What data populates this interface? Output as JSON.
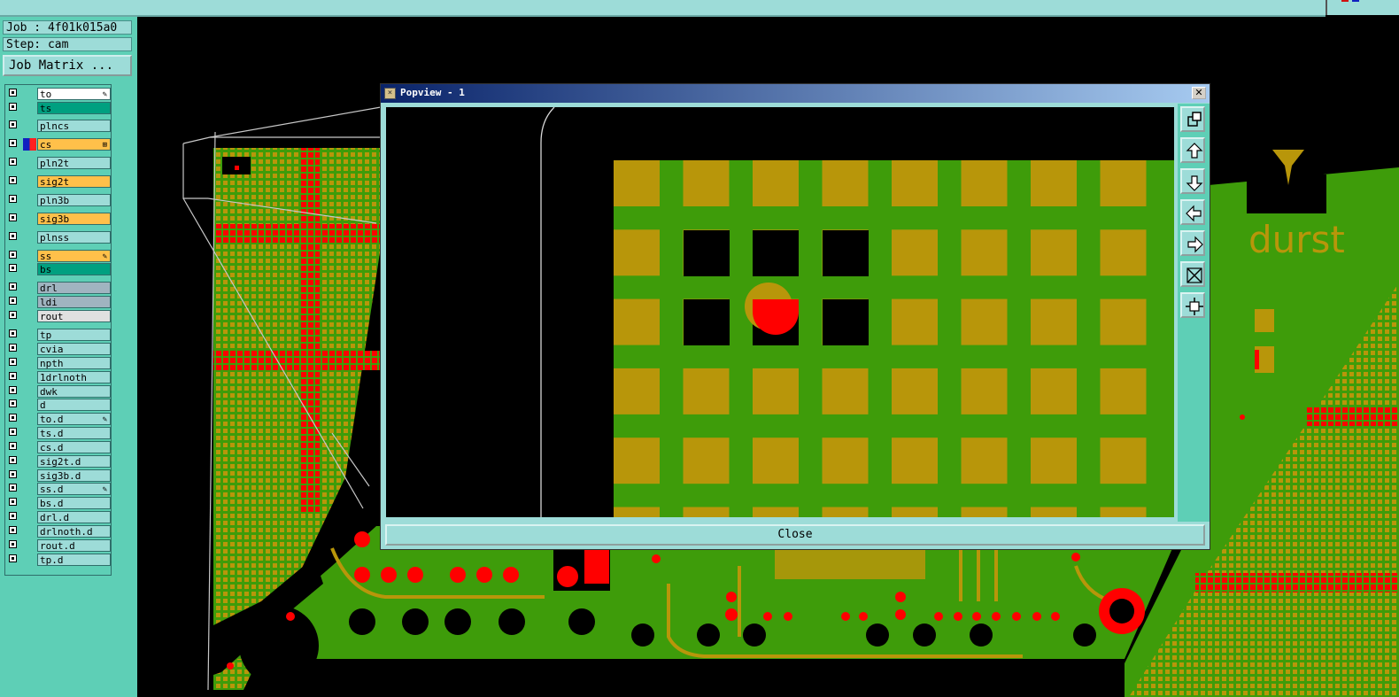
{
  "header": {
    "job_label": "Job : 4f01k015a0",
    "step_label": "Step: cam",
    "job_matrix_button": "Job Matrix ..."
  },
  "layers": [
    {
      "name": "to",
      "color": "#ffffff",
      "mark": "✎"
    },
    {
      "name": "ts",
      "color": "#00a080",
      "mark": ""
    },
    {
      "name": "plncs",
      "color": "#9ddcd8",
      "mark": ""
    },
    {
      "name": "cs",
      "color": "#ffc04a",
      "mark": "⊞"
    },
    {
      "name": "pln2t",
      "color": "#9ddcd8",
      "mark": ""
    },
    {
      "name": "sig2t",
      "color": "#ffc04a",
      "mark": ""
    },
    {
      "name": "pln3b",
      "color": "#9ddcd8",
      "mark": ""
    },
    {
      "name": "sig3b",
      "color": "#ffc04a",
      "mark": ""
    },
    {
      "name": "plnss",
      "color": "#9ddcd8",
      "mark": ""
    },
    {
      "name": "ss",
      "color": "#ffc04a",
      "mark": "✎"
    },
    {
      "name": "bs",
      "color": "#00a080",
      "mark": ""
    },
    {
      "name": "drl",
      "color": "#a0b4c0",
      "mark": ""
    },
    {
      "name": "ldi",
      "color": "#a0b4c0",
      "mark": ""
    },
    {
      "name": "rout",
      "color": "#e0e0e0",
      "mark": ""
    },
    {
      "name": "tp",
      "color": "#9ddcd8",
      "mark": ""
    },
    {
      "name": "cvia",
      "color": "#9ddcd8",
      "mark": ""
    },
    {
      "name": "npth",
      "color": "#9ddcd8",
      "mark": ""
    },
    {
      "name": "1drlnoth",
      "color": "#9ddcd8",
      "mark": ""
    },
    {
      "name": "dwk",
      "color": "#9ddcd8",
      "mark": ""
    },
    {
      "name": "d",
      "color": "#9ddcd8",
      "mark": ""
    },
    {
      "name": "to.d",
      "color": "#9ddcd8",
      "mark": "✎"
    },
    {
      "name": "ts.d",
      "color": "#9ddcd8",
      "mark": ""
    },
    {
      "name": "cs.d",
      "color": "#9ddcd8",
      "mark": ""
    },
    {
      "name": "sig2t.d",
      "color": "#9ddcd8",
      "mark": ""
    },
    {
      "name": "sig3b.d",
      "color": "#9ddcd8",
      "mark": ""
    },
    {
      "name": "ss.d",
      "color": "#9ddcd8",
      "mark": "✎"
    },
    {
      "name": "bs.d",
      "color": "#9ddcd8",
      "mark": ""
    },
    {
      "name": "drl.d",
      "color": "#9ddcd8",
      "mark": ""
    },
    {
      "name": "drlnoth.d",
      "color": "#9ddcd8",
      "mark": ""
    },
    {
      "name": "rout.d",
      "color": "#9ddcd8",
      "mark": ""
    },
    {
      "name": "tp.d",
      "color": "#9ddcd8",
      "mark": ""
    }
  ],
  "canvas": {
    "board_text": "durst",
    "colors": {
      "copper": "#b8960a",
      "board": "#3e9c0a",
      "pad": "#ff0000"
    }
  },
  "popview": {
    "title": "Popview - 1",
    "close_button": "Close",
    "tools": [
      "zoom-in-icon",
      "pan-up-icon",
      "pan-down-icon",
      "pan-left-icon",
      "pan-right-icon",
      "fit-icon",
      "center-icon"
    ]
  }
}
